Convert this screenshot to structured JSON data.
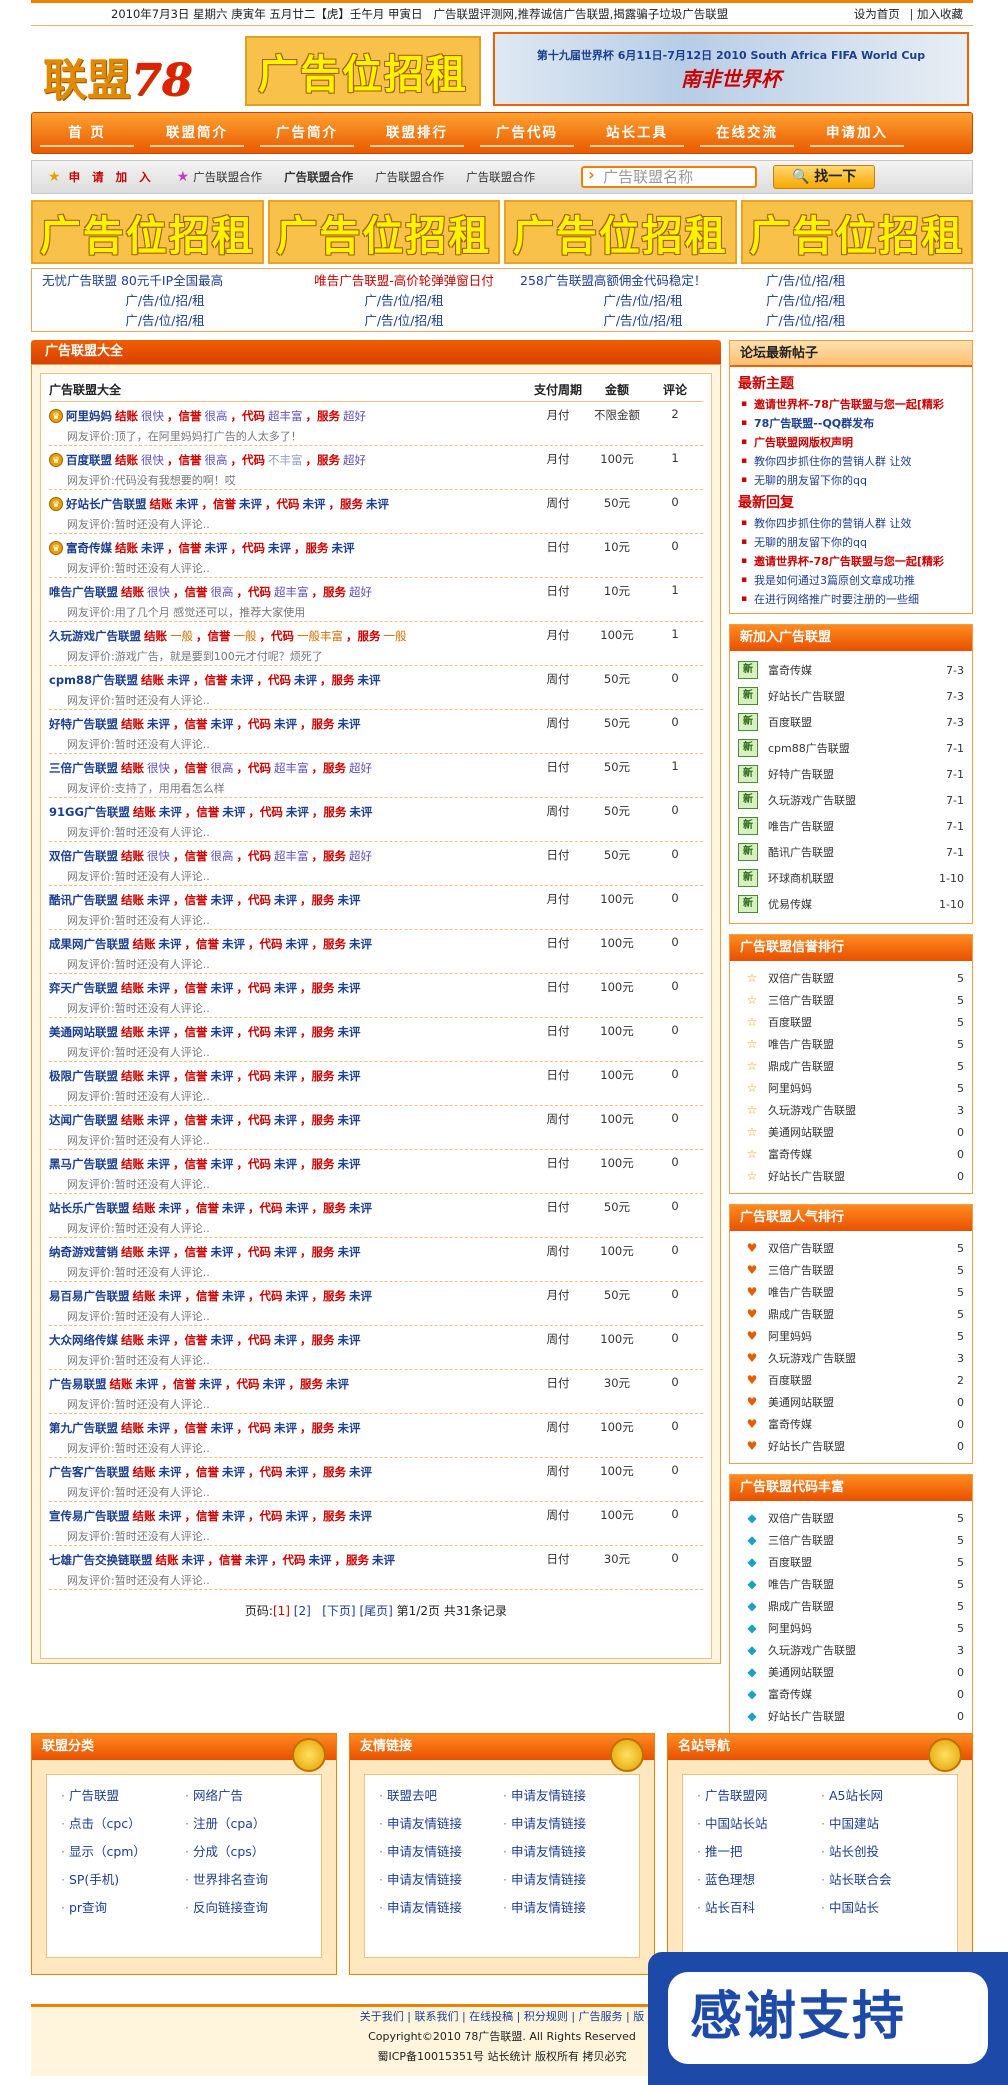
{
  "topbar": {
    "date": "2010年7月3日 星期六  庚寅年 五月廿二【虎】壬午月 甲寅日",
    "slogan": "广告联盟评测网,推荐诚信广告联盟,揭露骗子垃圾广告联盟",
    "set_home": "设为首页",
    "sep": "|",
    "favorite": "加入收藏"
  },
  "header": {
    "logo_cn": "联盟",
    "logo_num": "78",
    "ad_slot": "广告位招租",
    "worldcup_line1": "第十九届世界杯  6月11日-7月12日  2010 South Africa FIFA World Cup",
    "worldcup_line2": "南非世界杯"
  },
  "nav": [
    "首 页",
    "联盟简介",
    "广告简介",
    "联盟排行",
    "广告代码",
    "站长工具",
    "在线交流",
    "申请加入"
  ],
  "subbar": {
    "items": [
      "申 请 加 入",
      "广告联盟合作",
      "广告联盟合作",
      "广告联盟合作",
      "广告联盟合作"
    ],
    "search_placeholder": "广告联盟名称",
    "search_button": "找一下"
  },
  "big_ads": [
    "广告位招租",
    "广告位招租",
    "广告位招租",
    "广告位招租"
  ],
  "text_links": [
    "无忧广告联盟 80元千IP全国最高",
    "唯告广告联盟-高价轮弹弹窗日付",
    "258广告联盟高额佣金代码稳定！",
    "广/告/位/招/租",
    "广/告/位/招/租",
    "广/告/位/招/租",
    "广/告/位/招/租",
    "广/告/位/招/租",
    "广/告/位/招/租",
    "广/告/位/招/租",
    "广/告/位/招/租",
    "广/告/位/招/租"
  ],
  "main": {
    "section_title": "广告联盟大全",
    "headers": [
      "广告联盟大全",
      "支付周期",
      "金额",
      "评论"
    ],
    "labels": {
      "settle": "结账",
      "credit": "，信誉",
      "code": "，代码",
      "service": "，服务",
      "comment_prefix": "网友评价:"
    },
    "rows": [
      {
        "name": "阿里妈妈",
        "s": "很快",
        "c": "很高",
        "d": "超丰富",
        "v": "超好",
        "cm": "顶了，在阿里妈妈打广告的人太多了！",
        "p": "月付",
        "a": "不限金额",
        "n": "2",
        "badge": true,
        "st": "v1"
      },
      {
        "name": "百度联盟",
        "s": "很快",
        "c": "很高",
        "d": "不丰富",
        "v": "超好",
        "cm": "代码没有我想要的啊！哎",
        "p": "月付",
        "a": "100元",
        "n": "1",
        "badge": true,
        "st": "v1",
        "dst": "v2"
      },
      {
        "name": "好站长广告联盟",
        "s": "未评",
        "c": "未评",
        "d": "未评",
        "v": "未评",
        "cm": "暂时还没有人评论..",
        "p": "周付",
        "a": "50元",
        "n": "0",
        "badge": true
      },
      {
        "name": "富奇传媒",
        "s": "未评",
        "c": "未评",
        "d": "未评",
        "v": "未评",
        "cm": "暂时还没有人评论..",
        "p": "日付",
        "a": "10元",
        "n": "0",
        "badge": true
      },
      {
        "name": "唯告广告联盟",
        "s": "很快",
        "c": "很高",
        "d": "超丰富",
        "v": "超好",
        "cm": "用了几个月 感觉还可以，推荐大家使用",
        "p": "日付",
        "a": "10元",
        "n": "1",
        "st": "v1"
      },
      {
        "name": "久玩游戏广告联盟",
        "s": "一般",
        "c": "一般",
        "d": "一般丰富",
        "v": "一般",
        "cm": "游戏广告，就是要到100元才付呢？烦死了",
        "p": "月付",
        "a": "100元",
        "n": "1",
        "st": "v3"
      },
      {
        "name": "cpm88广告联盟",
        "s": "未评",
        "c": "未评",
        "d": "未评",
        "v": "未评",
        "cm": "暂时还没有人评论..",
        "p": "周付",
        "a": "50元",
        "n": "0"
      },
      {
        "name": "好特广告联盟",
        "s": "未评",
        "c": "未评",
        "d": "未评",
        "v": "未评",
        "cm": "暂时还没有人评论..",
        "p": "周付",
        "a": "50元",
        "n": "0"
      },
      {
        "name": "三倍广告联盟",
        "s": "很快",
        "c": "很高",
        "d": "超丰富",
        "v": "超好",
        "cm": "支持了，用用看怎么样",
        "p": "日付",
        "a": "50元",
        "n": "1",
        "st": "v1"
      },
      {
        "name": "91GG广告联盟",
        "s": "未评",
        "c": "未评",
        "d": "未评",
        "v": "未评",
        "cm": "暂时还没有人评论..",
        "p": "周付",
        "a": "50元",
        "n": "0"
      },
      {
        "name": "双倍广告联盟",
        "s": "很快",
        "c": "很高",
        "d": "超丰富",
        "v": "超好",
        "cm": "暂时还没有人评论..",
        "p": "日付",
        "a": "50元",
        "n": "0",
        "st": "v1"
      },
      {
        "name": "酷讯广告联盟",
        "s": "未评",
        "c": "未评",
        "d": "未评",
        "v": "未评",
        "cm": "暂时还没有人评论..",
        "p": "月付",
        "a": "100元",
        "n": "0"
      },
      {
        "name": "成果网广告联盟",
        "s": "未评",
        "c": "未评",
        "d": "未评",
        "v": "未评",
        "cm": "暂时还没有人评论..",
        "p": "日付",
        "a": "100元",
        "n": "0"
      },
      {
        "name": "弈天广告联盟",
        "s": "未评",
        "c": "未评",
        "d": "未评",
        "v": "未评",
        "cm": "暂时还没有人评论..",
        "p": "日付",
        "a": "100元",
        "n": "0"
      },
      {
        "name": "美通网站联盟",
        "s": "未评",
        "c": "未评",
        "d": "未评",
        "v": "未评",
        "cm": "暂时还没有人评论..",
        "p": "日付",
        "a": "100元",
        "n": "0"
      },
      {
        "name": "极限广告联盟",
        "s": "未评",
        "c": "未评",
        "d": "未评",
        "v": "未评",
        "cm": "暂时还没有人评论..",
        "p": "日付",
        "a": "100元",
        "n": "0"
      },
      {
        "name": "达闻广告联盟",
        "s": "未评",
        "c": "未评",
        "d": "未评",
        "v": "未评",
        "cm": "暂时还没有人评论..",
        "p": "周付",
        "a": "100元",
        "n": "0"
      },
      {
        "name": "黑马广告联盟",
        "s": "未评",
        "c": "未评",
        "d": "未评",
        "v": "未评",
        "cm": "暂时还没有人评论..",
        "p": "日付",
        "a": "100元",
        "n": "0"
      },
      {
        "name": "站长乐广告联盟",
        "s": "未评",
        "c": "未评",
        "d": "未评",
        "v": "未评",
        "cm": "暂时还没有人评论..",
        "p": "日付",
        "a": "50元",
        "n": "0"
      },
      {
        "name": "纳奇游戏营销",
        "s": "未评",
        "c": "未评",
        "d": "未评",
        "v": "未评",
        "cm": "暂时还没有人评论..",
        "p": "周付",
        "a": "100元",
        "n": "0"
      },
      {
        "name": "易百易广告联盟",
        "s": "未评",
        "c": "未评",
        "d": "未评",
        "v": "未评",
        "cm": "暂时还没有人评论..",
        "p": "月付",
        "a": "50元",
        "n": "0"
      },
      {
        "name": "大众网络传媒",
        "s": "未评",
        "c": "未评",
        "d": "未评",
        "v": "未评",
        "cm": "暂时还没有人评论..",
        "p": "周付",
        "a": "100元",
        "n": "0"
      },
      {
        "name": "广告易联盟",
        "s": "未评",
        "c": "未评",
        "d": "未评",
        "v": "未评",
        "cm": "暂时还没有人评论..",
        "p": "日付",
        "a": "30元",
        "n": "0"
      },
      {
        "name": "第九广告联盟",
        "s": "未评",
        "c": "未评",
        "d": "未评",
        "v": "未评",
        "cm": "暂时还没有人评论..",
        "p": "周付",
        "a": "100元",
        "n": "0"
      },
      {
        "name": "广告客广告联盟",
        "s": "未评",
        "c": "未评",
        "d": "未评",
        "v": "未评",
        "cm": "暂时还没有人评论..",
        "p": "周付",
        "a": "100元",
        "n": "0"
      },
      {
        "name": "宣传易广告联盟",
        "s": "未评",
        "c": "未评",
        "d": "未评",
        "v": "未评",
        "cm": "暂时还没有人评论..",
        "p": "周付",
        "a": "100元",
        "n": "0"
      },
      {
        "name": "七雄广告交换链联盟",
        "s": "未评",
        "c": "未评",
        "d": "未评",
        "v": "未评",
        "cm": "暂时还没有人评论..",
        "p": "日付",
        "a": "30元",
        "n": "0"
      }
    ],
    "pager": {
      "label": "页码:",
      "p1": "[1]",
      "p2": "[2]",
      "next": "[下页]",
      "last": "[尾页]",
      "info": "第1/2页 共31条记录"
    }
  },
  "side": {
    "forum": {
      "title": "论坛最新帖子",
      "latest_title": "最新主题",
      "latest": [
        {
          "t": "邀请世界杯-78广告联盟与您一起[精彩",
          "s": "r"
        },
        {
          "t": "78广告联盟--QQ群发布",
          "s": "g"
        },
        {
          "t": "广告联盟网版权声明",
          "s": "r"
        },
        {
          "t": "教你四步抓住你的营销人群 让效",
          "s": ""
        },
        {
          "t": "无聊的朋友留下你的qq",
          "s": ""
        }
      ],
      "reply_title": "最新回复",
      "replies": [
        {
          "t": "教你四步抓住你的营销人群 让效",
          "s": ""
        },
        {
          "t": "无聊的朋友留下你的qq",
          "s": ""
        },
        {
          "t": "邀请世界杯-78广告联盟与您一起[精彩",
          "s": "r"
        },
        {
          "t": "我是如何通过3篇原创文章成功推",
          "s": ""
        },
        {
          "t": "在进行网络推广时要注册的一些细",
          "s": ""
        }
      ]
    },
    "newjoin": {
      "title": "新加入广告联盟",
      "items": [
        {
          "t": "富奇传媒",
          "d": "7-3"
        },
        {
          "t": "好站长广告联盟",
          "d": "7-3"
        },
        {
          "t": "百度联盟",
          "d": "7-3"
        },
        {
          "t": "cpm88广告联盟",
          "d": "7-1"
        },
        {
          "t": "好特广告联盟",
          "d": "7-1"
        },
        {
          "t": "久玩游戏广告联盟",
          "d": "7-1"
        },
        {
          "t": "唯告广告联盟",
          "d": "7-1"
        },
        {
          "t": "酷讯广告联盟",
          "d": "7-1"
        },
        {
          "t": "环球商机联盟",
          "d": "1-10"
        },
        {
          "t": "优易传媒",
          "d": "1-10"
        }
      ]
    },
    "credit": {
      "title": "广告联盟信誉排行",
      "items": [
        {
          "t": "双倍广告联盟",
          "n": "5"
        },
        {
          "t": "三倍广告联盟",
          "n": "5"
        },
        {
          "t": "百度联盟",
          "n": "5"
        },
        {
          "t": "唯告广告联盟",
          "n": "5"
        },
        {
          "t": "鼎成广告联盟",
          "n": "5"
        },
        {
          "t": "阿里妈妈",
          "n": "5"
        },
        {
          "t": "久玩游戏广告联盟",
          "n": "3"
        },
        {
          "t": "美通网站联盟",
          "n": "0"
        },
        {
          "t": "富奇传媒",
          "n": "0"
        },
        {
          "t": "好站长广告联盟",
          "n": "0"
        }
      ]
    },
    "popular": {
      "title": "广告联盟人气排行",
      "items": [
        {
          "t": "双倍广告联盟",
          "n": "5"
        },
        {
          "t": "三倍广告联盟",
          "n": "5"
        },
        {
          "t": "唯告广告联盟",
          "n": "5"
        },
        {
          "t": "鼎成广告联盟",
          "n": "5"
        },
        {
          "t": "阿里妈妈",
          "n": "5"
        },
        {
          "t": "久玩游戏广告联盟",
          "n": "3"
        },
        {
          "t": "百度联盟",
          "n": "2"
        },
        {
          "t": "美通网站联盟",
          "n": "0"
        },
        {
          "t": "富奇传媒",
          "n": "0"
        },
        {
          "t": "好站长广告联盟",
          "n": "0"
        }
      ]
    },
    "code": {
      "title": "广告联盟代码丰富",
      "items": [
        {
          "t": "双倍广告联盟",
          "n": "5"
        },
        {
          "t": "三倍广告联盟",
          "n": "5"
        },
        {
          "t": "百度联盟",
          "n": "5"
        },
        {
          "t": "唯告广告联盟",
          "n": "5"
        },
        {
          "t": "鼎成广告联盟",
          "n": "5"
        },
        {
          "t": "阿里妈妈",
          "n": "5"
        },
        {
          "t": "久玩游戏广告联盟",
          "n": "3"
        },
        {
          "t": "美通网站联盟",
          "n": "0"
        },
        {
          "t": "富奇传媒",
          "n": "0"
        },
        {
          "t": "好站长广告联盟",
          "n": "0"
        }
      ]
    }
  },
  "bottom": [
    {
      "title": "联盟分类",
      "items": [
        "广告联盟",
        "网络广告",
        "点击（cpc）",
        "注册（cpa）",
        "显示（cpm）",
        "分成（cps）",
        "SP(手机)",
        "世界排名查询",
        "pr查询",
        "反向链接查询"
      ]
    },
    {
      "title": "友情链接",
      "items": [
        "联盟去吧",
        "申请友情链接",
        "申请友情链接",
        "申请友情链接",
        "申请友情链接",
        "申请友情链接",
        "申请友情链接",
        "申请友情链接",
        "申请友情链接",
        "申请友情链接"
      ]
    },
    {
      "title": "名站导航",
      "items": [
        "广告联盟网",
        "A5站长网",
        "中国站长站",
        "中国建站",
        "推一把",
        "站长创投",
        "蓝色理想",
        "站长联合会",
        "站长百科",
        "中国站长"
      ]
    }
  ],
  "footer": {
    "links": "关于我们 | 联系我们 | 在线投稿 | 积分规则 | 广告服务 | 版",
    "copyright": "Copyright©2010 78广告联盟. All Rights Reserved",
    "icp": "蜀ICP备10015351号 站长统计 版权所有 拷贝必究"
  },
  "thanks": "感谢支持"
}
